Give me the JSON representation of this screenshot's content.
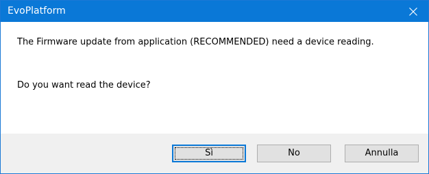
{
  "window": {
    "title": "EvoPlatform",
    "close_icon": "close-icon"
  },
  "message": {
    "line1": "The Firmware update from application (RECOMMENDED) need a device reading.",
    "line2": "Do you want read the device?"
  },
  "buttons": {
    "yes": "Sì",
    "no": "No",
    "cancel": "Annulla"
  },
  "colors": {
    "titlebar": "#0a78d7",
    "accent": "#0a78d7"
  }
}
